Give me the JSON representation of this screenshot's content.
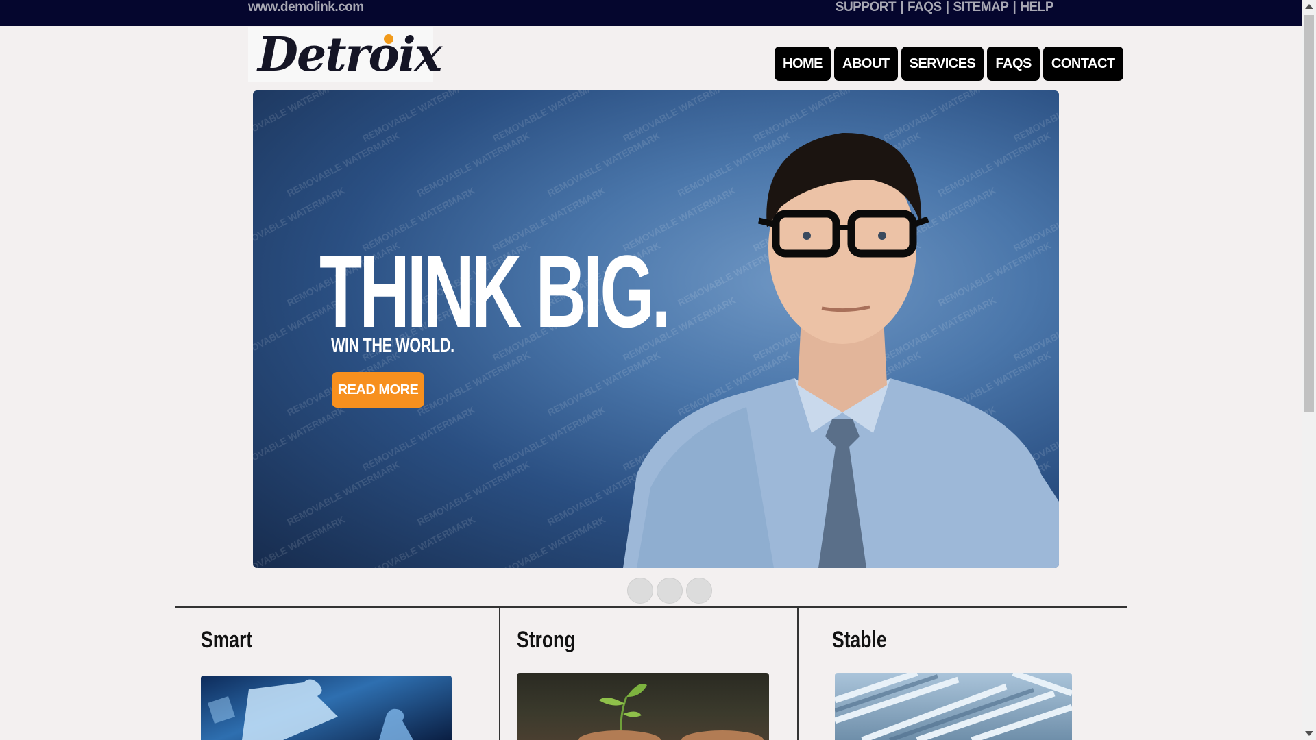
{
  "topbar": {
    "site_url": "www.demolink.com",
    "links": [
      "SUPPORT",
      "FAQS",
      "SITEMAP",
      "HELP"
    ],
    "separator": "|"
  },
  "logo": {
    "text": "Detroix"
  },
  "nav": {
    "items": [
      "HOME",
      "ABOUT",
      "SERVICES",
      "FAQS",
      "CONTACT"
    ]
  },
  "hero": {
    "headline": "THINK BIG.",
    "subline": "WIN THE WORLD.",
    "cta": "READ MORE",
    "watermark_text": "REMOVABLE WATERMARK"
  },
  "slider": {
    "dot_count": 3
  },
  "features": [
    {
      "title": "Smart",
      "image": "puzzle-pieces"
    },
    {
      "title": "Strong",
      "image": "seedling-in-hands"
    },
    {
      "title": "Stable",
      "image": "maze"
    }
  ],
  "colors": {
    "topbar_bg": "#05062e",
    "accent": "#f7901e",
    "nav_bg": "#000000",
    "page_bg": "#f3f0f0"
  }
}
